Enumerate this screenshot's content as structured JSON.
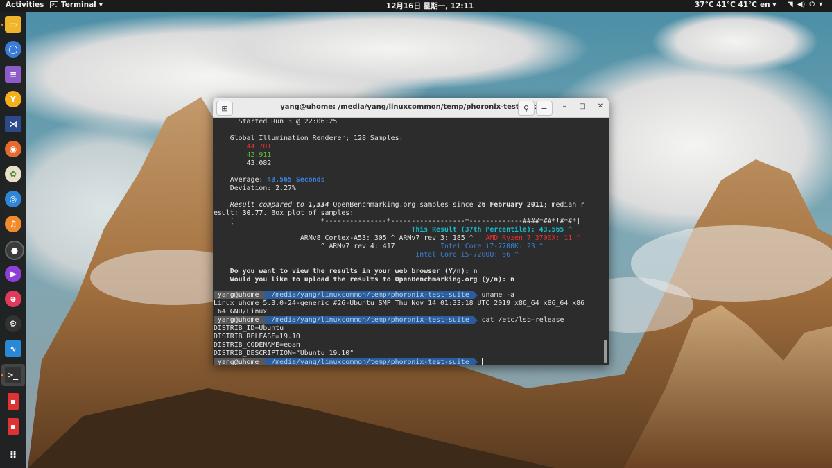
{
  "topbar": {
    "activities": "Activities",
    "app_menu": "Terminal",
    "clock": "12月16日 星期一, 12:11",
    "temps": "37°C  41°C  41°C",
    "lang": "en"
  },
  "dock": {
    "items": [
      "files-icon",
      "chromium-icon",
      "text-editor-icon",
      "yandex-icon",
      "vscode-icon",
      "firefox-icon",
      "chrome-icon",
      "screenshot-icon",
      "music-icon",
      "obs-icon",
      "video-player-icon",
      "app-icon",
      "steam-icon",
      "monitor-icon",
      "terminal-icon",
      "pdf-icon",
      "pdf-icon-2",
      "show-apps-icon"
    ]
  },
  "window": {
    "title": "yang@uhome: /media/yang/linuxcommon/temp/phoronix-test-suite"
  },
  "terminal": {
    "l01": "      Started Run 3 @ 22:06:25",
    "l02": "    Global Illumination Renderer; 128 Samples:",
    "l03a": "        ",
    "l03b": "44.701",
    "l04b": "42.911",
    "l05b": "43.082",
    "l06a": "    Average: ",
    "l06b": "43.565 Seconds",
    "l07": "    Deviation: 2.27%",
    "l08a": "    Result compared to ",
    "l08b": "1,534",
    "l08c": " OpenBenchmarking.org samples since ",
    "l08d": "26 February 2011",
    "l08e": "; median r",
    "l09a": "esult: ",
    "l09b": "30.77",
    "l09c": ". Box plot of samples:",
    "l10a": "    [                     ",
    "l10b": "*---------------*------------------*-------------####*##*!#*#*]",
    "l11a": "                                                ",
    "l11b": "This Result (37th Percentile): 43.565 ^",
    "l12a": "                     ARMv8 Cortex-A53: 305 ^ ARMv7 rev 3: 185 ^   ",
    "l12b": "AMD Ryzen 7 3700X: 11 ^",
    "l13a": "                          ^ ARMv7 rev 4: 417           ",
    "l13b": "Intel Core i7-7700K: 23 ^",
    "l14a": "                                                 ",
    "l14b": "Intel Core i5-7200U: 66 ^",
    "l15": "    Do you want to view the results in your web browser (Y/n): n",
    "l16": "    Would you like to upload the results to OpenBenchmarking.org (y/n): n",
    "prompt_user": " yang@uhome ",
    "prompt_path": " /media/yang/linuxcommon/temp/phoronix-test-suite ",
    "cmd1": " uname -a",
    "out1a": "Linux uhome 5.3.0-24-generic #26-Ubuntu SMP Thu Nov 14 01:33:18 UTC 2019 x86_64 x86_64 x86",
    "out1b": "_64 GNU/Linux",
    "cmd2": " cat /etc/lsb-release",
    "out2a": "DISTRIB_ID=Ubuntu",
    "out2b": "DISTRIB_RELEASE=19.10",
    "out2c": "DISTRIB_CODENAME=eoan",
    "out2d": "DISTRIB_DESCRIPTION=\"Ubuntu 19.10\""
  }
}
